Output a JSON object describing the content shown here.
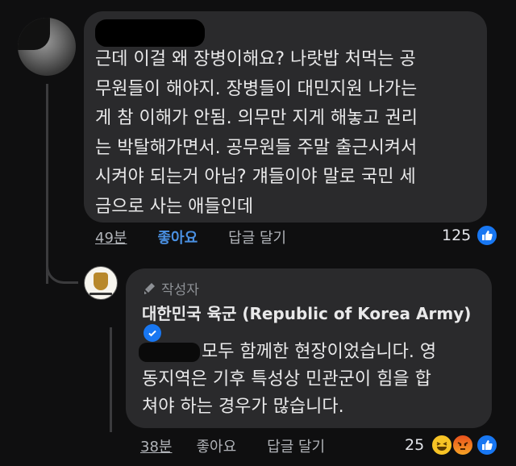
{
  "comment": {
    "text": "근데 이걸 왜 장병이해요? 나랏밥 처먹는 공\n무원들이 해야지. 장병들이 대민지원 나가는\n게 참 이해가 안됨. 의무만 지게 해놓고 권리\n는 박탈해가면서. 공무원들 주말 출근시켜서\n시켜야 되는거 아님? 걔들이야 말로 국민 세\n금으로 사는 애들인데",
    "time": "49분",
    "like_label": "좋아요",
    "reply_label": "답글 달기",
    "reaction_count": "125",
    "reactions": [
      "like-icon"
    ]
  },
  "reply": {
    "badge_label": "작성자",
    "author": "대한민국 육군 (Republic of Korea Army)",
    "text": "모두 함께한 현장이었습니다. 영\n동지역은 기후 특성상 민관군이 힘을 합\n쳐야 하는 경우가 많습니다.",
    "time": "38분",
    "like_label": "좋아요",
    "reply_label": "답글 달기",
    "reaction_count": "25",
    "reactions": [
      "haha-icon",
      "angry-icon",
      "like-icon"
    ]
  },
  "colors": {
    "background": "#0f0f10",
    "bubble": "#2a2a2c",
    "like_active": "#4a90e2",
    "facebook_blue": "#1877f2"
  }
}
